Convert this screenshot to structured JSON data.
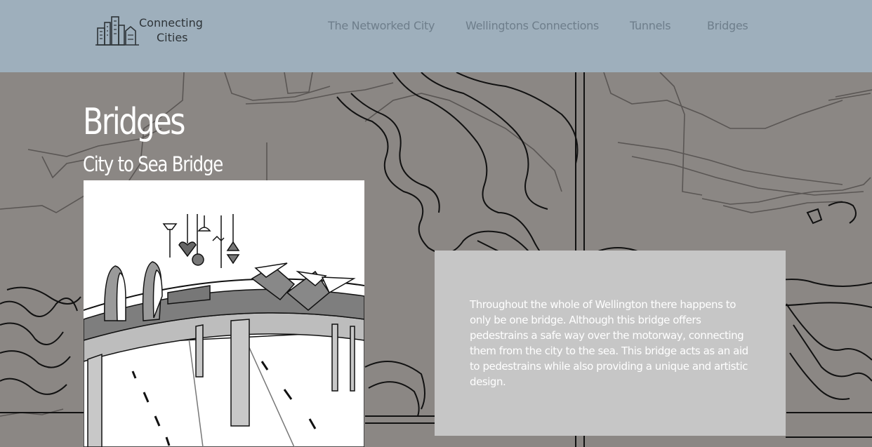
{
  "header": {
    "logo": {
      "line1": "Connecting",
      "line2": "Cities"
    },
    "nav": [
      {
        "label": "The Networked City"
      },
      {
        "label": "Wellingtons Connections"
      },
      {
        "label": "Tunnels"
      },
      {
        "label": "Bridges"
      }
    ]
  },
  "main": {
    "title": "Bridges",
    "subtitle": "City to Sea Bridge",
    "description": "Throughout the whole of Wellington there happens to only be one bridge. Although this bridge offers pedestrains a safe way over the motorway, connecting them from the city to the sea. This bridge acts as an aid to pedestrains while also providing a unique and artistic design."
  },
  "colors": {
    "header_bg": "#9eafbc",
    "nav_text": "#6e7e8b",
    "page_bg": "#8b8784",
    "card_bg": "#c6c6c6",
    "heading_text": "#ffffff"
  }
}
